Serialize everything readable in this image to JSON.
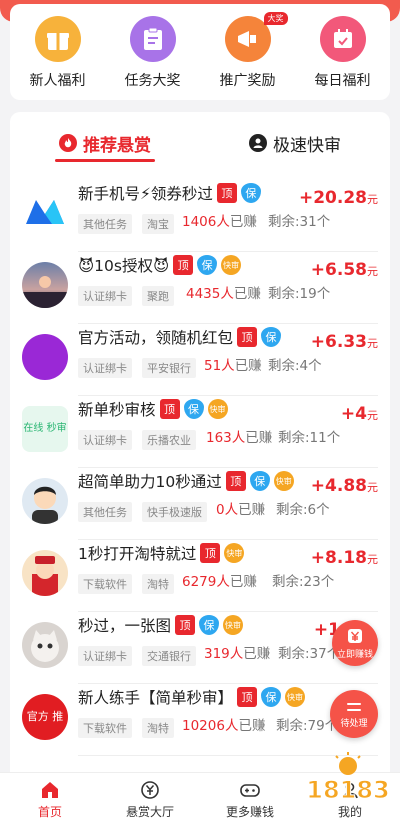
{
  "shortcuts": [
    {
      "label": "新人福利",
      "icon": "gift-icon",
      "color": "#f7b23b"
    },
    {
      "label": "任务大奖",
      "icon": "clipboard-icon",
      "color": "#a873e8"
    },
    {
      "label": "推广奖励",
      "icon": "megaphone-icon",
      "color": "#f5843a",
      "badge": "大奖"
    },
    {
      "label": "每日福利",
      "icon": "calendar-icon",
      "color": "#f2587a"
    }
  ],
  "tabs": [
    {
      "label": "推荐悬赏",
      "icon": "flame-icon",
      "active": true
    },
    {
      "label": "极速快审",
      "icon": "user-icon",
      "active": false
    }
  ],
  "tasks": [
    {
      "title": "新手机号⚡领券秒过",
      "chips": [
        "顶",
        "保"
      ],
      "tags": [
        "其他任务",
        "淘宝"
      ],
      "earned_n": "1406人",
      "earned_s": "已赚",
      "remain": "剩余:31个",
      "price": "+20.28",
      "unit": "元",
      "avatar": "logo-m-icon"
    },
    {
      "title": "😈10s授权😈",
      "chips": [
        "顶",
        "保",
        "快审"
      ],
      "tags": [
        "认证绑卡",
        "聚跑"
      ],
      "earned_n": "4435人",
      "earned_s": "已赚",
      "remain": "剩余:19个",
      "price": "+6.58",
      "unit": "元",
      "avatar": "sunset-photo-icon"
    },
    {
      "title": "官方活动，领随机红包",
      "chips": [
        "顶",
        "保"
      ],
      "tags": [
        "认证绑卡",
        "平安银行"
      ],
      "earned_n": "51人",
      "earned_s": "已赚",
      "remain": "剩余:4个",
      "price": "+6.33",
      "unit": "元",
      "avatar": "purple-circle-icon"
    },
    {
      "title": "新单秒审核",
      "chips": [
        "顶",
        "保",
        "快审"
      ],
      "tags": [
        "认证绑卡",
        "乐播农业"
      ],
      "earned_n": "163人",
      "earned_s": "已赚",
      "remain": "剩余:11个",
      "price": "+4",
      "unit": "元",
      "avatar": "online-review-icon",
      "avatar_text": "在线 秒审"
    },
    {
      "title": "超简单助力10秒通过",
      "chips": [
        "顶",
        "保",
        "快审"
      ],
      "tags": [
        "其他任务",
        "快手极速版"
      ],
      "earned_n": "0人",
      "earned_s": "已赚",
      "remain": "剩余:6个",
      "price": "+4.88",
      "unit": "元",
      "avatar": "cartoon-man-icon"
    },
    {
      "title": "1秒打开淘特就过",
      "chips": [
        "顶",
        "快审"
      ],
      "tags": [
        "下载软件",
        "淘特"
      ],
      "earned_n": "6279人",
      "earned_s": "已赚",
      "remain": "剩余:23个",
      "price": "+8.18",
      "unit": "元",
      "avatar": "fortune-god-icon"
    },
    {
      "title": "秒过，一张图",
      "chips": [
        "顶",
        "保",
        "快审"
      ],
      "tags": [
        "认证绑卡",
        "交通银行"
      ],
      "earned_n": "319人",
      "earned_s": "已赚",
      "remain": "剩余:37个",
      "price": "+1",
      "unit": "",
      "avatar": "kitten-photo-icon"
    },
    {
      "title": "新人练手【简单秒审】",
      "chips": [
        "顶",
        "保",
        "快审"
      ],
      "tags": [
        "下载软件",
        "淘特"
      ],
      "earned_n": "10206人",
      "earned_s": "已赚",
      "remain": "剩余:79个",
      "price": "",
      "unit": "",
      "avatar": "official-push-icon",
      "avatar_text": "官方 推"
    }
  ],
  "float_buttons": [
    {
      "label": "立即赚钱",
      "icon": "yen-icon"
    },
    {
      "label": "待处理",
      "icon": "pending-icon"
    }
  ],
  "nav": [
    {
      "label": "首页",
      "icon": "home-icon",
      "active": true
    },
    {
      "label": "悬赏大厅",
      "icon": "yen-circle-icon",
      "active": false
    },
    {
      "label": "更多赚钱",
      "icon": "gamepad-icon",
      "active": false
    },
    {
      "label": "我的",
      "icon": "user-icon",
      "active": false
    }
  ],
  "watermark_text": "18183",
  "colors": {
    "accent": "#e8282e",
    "brand_banner": "#f25b4e",
    "blue_chip": "#2ea7f0",
    "orange_chip": "#f5a623"
  }
}
